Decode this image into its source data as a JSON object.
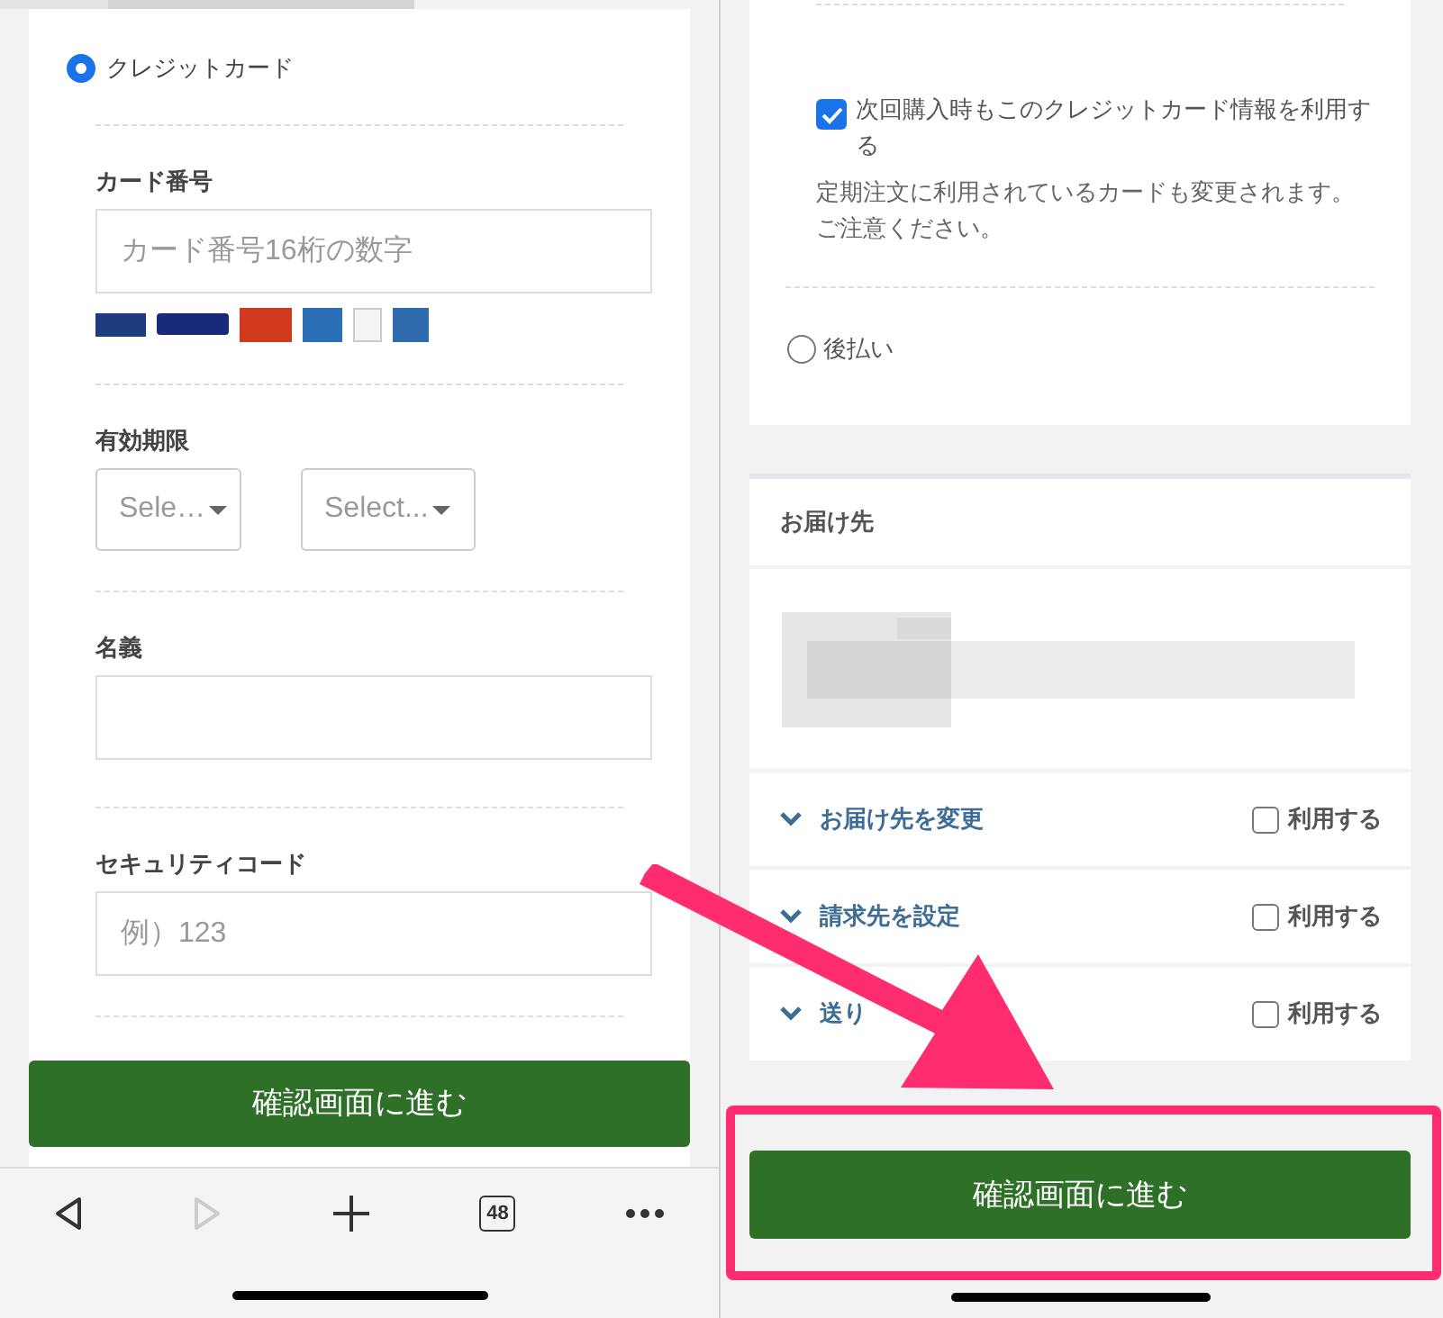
{
  "left_screen": {
    "payment_option": {
      "label": "クレジットカード",
      "selected": true
    },
    "card_number": {
      "label": "カード番号",
      "placeholder": "カード番号16桁の数字"
    },
    "expiry": {
      "label": "有効期限",
      "selects": [
        {
          "value": "Sele…"
        },
        {
          "value": "Select..."
        }
      ]
    },
    "holder_name": {
      "label": "名義"
    },
    "security_code": {
      "label": "セキュリティコード",
      "placeholder": "例）123"
    },
    "submit_button": "確認画面に進む",
    "toolbar": {
      "tab_count": "48",
      "forward_disabled": true
    }
  },
  "right_screen": {
    "save_card": {
      "label": "次回購入時もこのクレジットカード情報を利用する",
      "checked": true
    },
    "note": "定期注文に利用されているカードも変更されます。ご注意ください。",
    "payment_option": {
      "label": "後払い",
      "selected": false
    },
    "delivery_title": "お届け先",
    "options": [
      {
        "label": "お届け先を変更",
        "checkbox_label": "利用する",
        "checked": false
      },
      {
        "label": "請求先を設定",
        "checkbox_label": "利用する",
        "checked": false
      },
      {
        "label": "送り",
        "checkbox_label": "利用する",
        "checked": false
      }
    ],
    "submit_button": "確認画面に進む"
  }
}
